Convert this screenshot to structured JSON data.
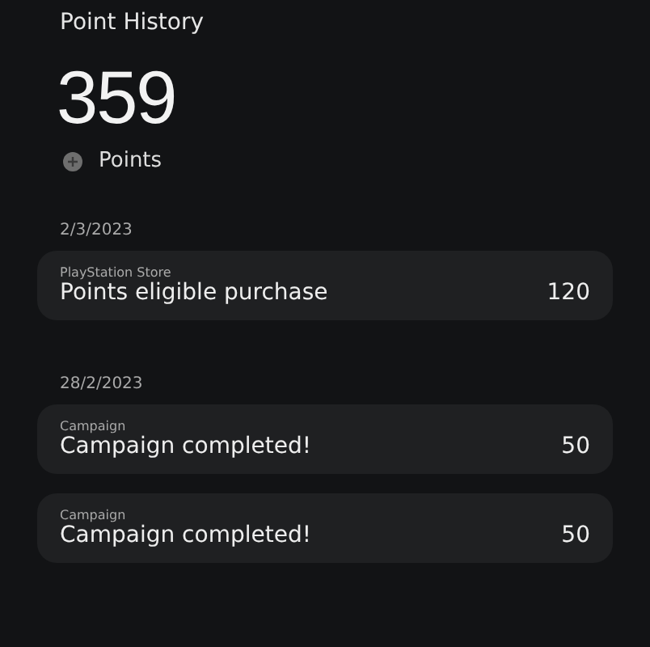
{
  "header": {
    "title": "Point History",
    "total": "359",
    "unit": "Points"
  },
  "groups": [
    {
      "date": "2/3/2023",
      "entries": [
        {
          "source": "PlayStation Store",
          "description": "Points eligible purchase",
          "points": "120"
        }
      ]
    },
    {
      "date": "28/2/2023",
      "entries": [
        {
          "source": "Campaign",
          "description": "Campaign completed!",
          "points": "50"
        },
        {
          "source": "Campaign",
          "description": "Campaign completed!",
          "points": "50"
        }
      ]
    }
  ]
}
